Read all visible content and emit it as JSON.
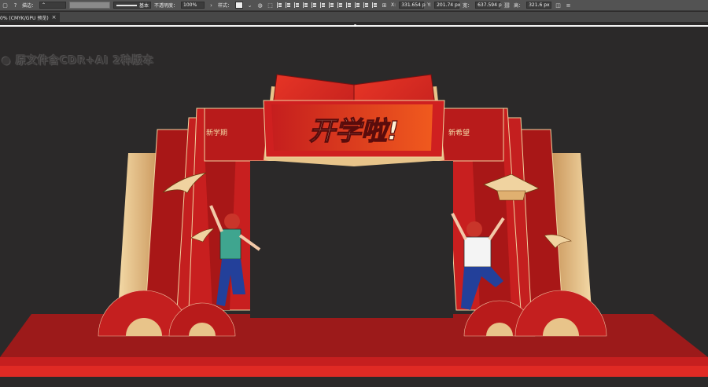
{
  "control_bar": {
    "stroke_label": "描边：",
    "brush_label": "基本",
    "opacity_label": "不透明度：",
    "opacity_value": "100%",
    "style_label": "样式：",
    "x_label": "X:",
    "x_value": "331.654",
    "x_unit": "p",
    "y_label": "Y:",
    "y_value": "201.74",
    "y_unit": "px",
    "width_label": "宽：",
    "width_value": "637.594",
    "width_unit": "p",
    "height_label": "高：",
    "height_value": "321.6",
    "height_unit": "px"
  },
  "tab_bar": {
    "tab_label": "0% (CMYK/GPU 预览)",
    "close_glyph": "×"
  },
  "canvas": {
    "artboard_label": "原文件含CDR+AI 2种版本",
    "banner_text": "开学啦!",
    "left_panel_text": "新学期",
    "right_panel_text": "新希望"
  },
  "colors": {
    "canvas_bg": "#2b2929",
    "red_main": "#b01c1c",
    "red_bright": "#d82a20",
    "gold": "#e8c48a",
    "stage": "#9c1a1a"
  }
}
